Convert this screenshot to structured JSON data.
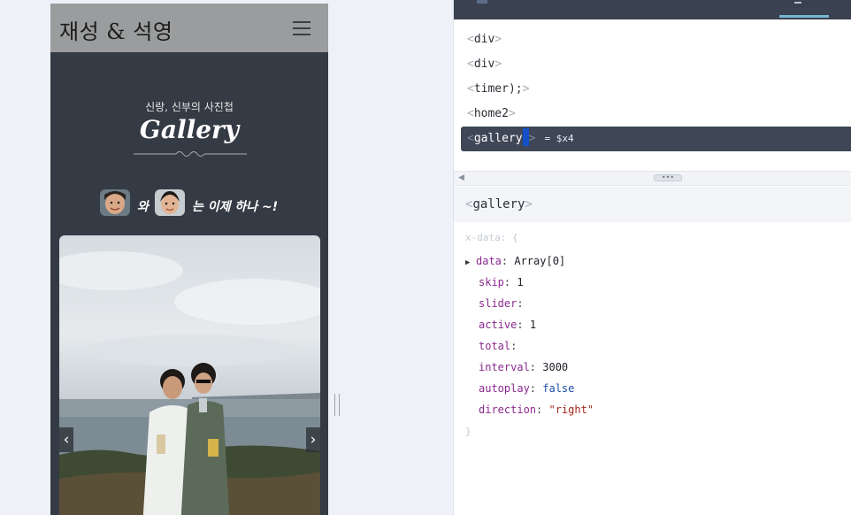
{
  "preview": {
    "site_title": "재성 & 석영",
    "gallery_subtitle": "신랑, 신부의 사진첩",
    "gallery_title": "Gallery",
    "couple_text_1": "와",
    "couple_text_2": "는 이제 하나 ~!",
    "prev_arrow": "‹",
    "next_arrow": "›",
    "header_color": "#9a9c9d",
    "page_bg_color": "#353b44"
  },
  "devtools": {
    "tree": [
      {
        "tag": "div",
        "open": "<",
        "close": ">"
      },
      {
        "tag": "div",
        "open": "<",
        "close": ">"
      },
      {
        "tag": "timer);",
        "open": "<",
        "close": ">"
      },
      {
        "tag": "home2",
        "open": "<",
        "close": ">"
      },
      {
        "tag": "gallery",
        "open": "<",
        "close": ">",
        "selected": true,
        "var_ref": "= $x4"
      }
    ],
    "detail_tag": "gallery",
    "detail_open": "<",
    "detail_close": ">",
    "xdata_open": "x-data: {",
    "xdata_close": "}",
    "props": [
      {
        "key": "data",
        "value": "Array[0]",
        "type": "plain",
        "expandable": true
      },
      {
        "key": "skip",
        "value": "1",
        "type": "num"
      },
      {
        "key": "slider",
        "value": "",
        "type": "plain"
      },
      {
        "key": "active",
        "value": "1",
        "type": "num"
      },
      {
        "key": "total",
        "value": "",
        "type": "plain"
      },
      {
        "key": "interval",
        "value": "3000",
        "type": "num"
      },
      {
        "key": "autoplay",
        "value": "false",
        "type": "bool"
      },
      {
        "key": "direction",
        "value": "\"right\"",
        "type": "str"
      }
    ],
    "collapse_arrow": "◀",
    "grip_dots": "•••",
    "selected_color": "#3f4757"
  }
}
